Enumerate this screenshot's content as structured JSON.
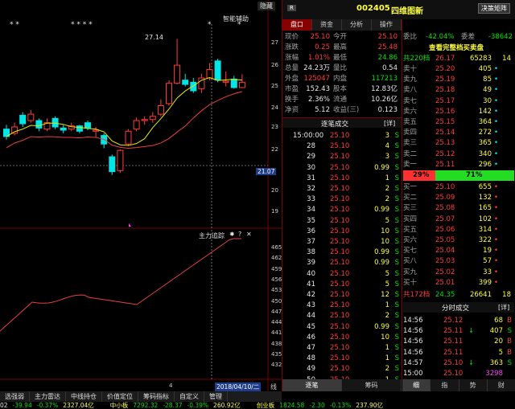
{
  "chart": {
    "top_button": "隐藏",
    "indicator_title": "智能辅助",
    "stars_left": "* *",
    "stars_mid": "* * * *",
    "stars_r1": "*",
    "stars_r2": "*",
    "high_label": "27.14",
    "price_label": "21.07",
    "price_axis": [
      "27",
      "26",
      "25",
      "24",
      "23",
      "22",
      "20",
      "19"
    ],
    "sub_title": "主力追踪",
    "sub_axis": [
      "465",
      "462",
      "459",
      "456",
      "453",
      "450",
      "447",
      "444",
      "441",
      "438",
      "435",
      "432"
    ],
    "date_label": "2018/04/10/二",
    "date_right": "线",
    "page_num": "4",
    "sub_icons": [
      "✸",
      "?",
      "✕"
    ]
  },
  "toolbar": [
    "选强弱",
    "主力雷达",
    "中线持仓",
    "价值定位",
    "筹码指标",
    "自定义",
    "管理"
  ],
  "header": {
    "badge": "R",
    "code": "002405",
    "name": "四维图新",
    "button": "决策矩阵"
  },
  "tabs": [
    "盘口",
    "资金",
    "分析",
    "操作"
  ],
  "quote": [
    {
      "l": "现价",
      "v": "25.10",
      "l2": "今开",
      "v2": "25.10"
    },
    {
      "l": "涨跌",
      "v": "0.25",
      "l2": "最高",
      "v2": "25.48"
    },
    {
      "l": "涨幅",
      "v": "1.01%",
      "l2": "最低",
      "v2": "24.86"
    },
    {
      "l": "总量",
      "v": "24.23万",
      "l2": "量比",
      "v2": "0.54"
    },
    {
      "l": "外盘",
      "v": "125047",
      "l2": "内盘",
      "v2": "117213"
    },
    {
      "l": "市盈",
      "v": "152.43",
      "l2": "股本",
      "v2": "12.83亿"
    },
    {
      "l": "换手",
      "v": "2.36%",
      "l2": "流通",
      "v2": "10.26亿"
    },
    {
      "l": "净资",
      "v": "5.12",
      "l2": "收益(三)",
      "v2": "0.123"
    }
  ],
  "ticks_header": {
    "title": "逐笔成交",
    "detail": "[详]"
  },
  "ticks": [
    {
      "t": "15:00:00",
      "p": "25.10",
      "q": "3",
      "s": "S"
    },
    {
      "t": "28",
      "p": "25.10",
      "q": "4",
      "s": "S"
    },
    {
      "t": "29",
      "p": "25.10",
      "q": "3",
      "s": "S"
    },
    {
      "t": "30",
      "p": "25.10",
      "q": "0.99",
      "s": "S"
    },
    {
      "t": "31",
      "p": "25.10",
      "q": "1",
      "s": "S"
    },
    {
      "t": "32",
      "p": "25.10",
      "q": "2",
      "s": "S"
    },
    {
      "t": "33",
      "p": "25.10",
      "q": "2",
      "s": "S"
    },
    {
      "t": "34",
      "p": "25.10",
      "q": "0.99",
      "s": "S"
    },
    {
      "t": "35",
      "p": "25.10",
      "q": "5",
      "s": "S"
    },
    {
      "t": "36",
      "p": "25.10",
      "q": "10",
      "s": "S"
    },
    {
      "t": "37",
      "p": "25.10",
      "q": "10",
      "s": "S"
    },
    {
      "t": "38",
      "p": "25.10",
      "q": "0.99",
      "s": "S"
    },
    {
      "t": "39",
      "p": "25.10",
      "q": "0.99",
      "s": "S"
    },
    {
      "t": "40",
      "p": "25.10",
      "q": "5",
      "s": "S"
    },
    {
      "t": "41",
      "p": "25.10",
      "q": "5",
      "s": "S"
    },
    {
      "t": "42",
      "p": "25.10",
      "q": "12",
      "s": "S"
    },
    {
      "t": "43",
      "p": "25.10",
      "q": "1",
      "s": "S"
    },
    {
      "t": "44",
      "p": "25.10",
      "q": "2",
      "s": "S"
    },
    {
      "t": "45",
      "p": "25.10",
      "q": "0.99",
      "s": "S"
    },
    {
      "t": "46",
      "p": "25.10",
      "q": "10",
      "s": "S"
    },
    {
      "t": "47",
      "p": "25.10",
      "q": "1",
      "s": "S"
    },
    {
      "t": "48",
      "p": "25.10",
      "q": "1",
      "s": "S"
    },
    {
      "t": "49",
      "p": "25.10",
      "q": "2",
      "s": "S"
    },
    {
      "t": "50",
      "p": "25.10",
      "q": "1",
      "s": "S"
    }
  ],
  "book_top": {
    "wb_label": "委比",
    "wb": "-42.04%",
    "wc_label": "委差",
    "wc": "-38642",
    "link": "查看完整档买卖盘",
    "sum_label": "共220档",
    "sum_price": "26.17",
    "sum_vol": "65283",
    "sum_n": "14"
  },
  "asks": [
    {
      "l": "卖十",
      "p": "25.20",
      "v": "405",
      "m": "•"
    },
    {
      "l": "卖九",
      "p": "25.19",
      "v": "85",
      "m": "•"
    },
    {
      "l": "卖八",
      "p": "25.18",
      "v": "49",
      "m": "•"
    },
    {
      "l": "卖七",
      "p": "25.17",
      "v": "30",
      "m": "•"
    },
    {
      "l": "卖六",
      "p": "25.16",
      "v": "142",
      "m": "•"
    },
    {
      "l": "卖五",
      "p": "25.15",
      "v": "364",
      "m": "•"
    },
    {
      "l": "卖四",
      "p": "25.14",
      "v": "272",
      "m": "•"
    },
    {
      "l": "卖三",
      "p": "25.13",
      "v": "365",
      "m": "•"
    },
    {
      "l": "卖二",
      "p": "25.12",
      "v": "340",
      "m": "•"
    },
    {
      "l": "卖一",
      "p": "25.11",
      "v": "296",
      "m": "•"
    }
  ],
  "ratio": {
    "sell": "29%",
    "buy": "71%",
    "buy_frac": 0.71
  },
  "bids": [
    {
      "l": "买一",
      "p": "25.10",
      "v": "655",
      "m": "•"
    },
    {
      "l": "买二",
      "p": "25.09",
      "v": "132",
      "m": "•"
    },
    {
      "l": "买三",
      "p": "25.08",
      "v": "165",
      "m": "•"
    },
    {
      "l": "买四",
      "p": "25.07",
      "v": "102",
      "m": "•"
    },
    {
      "l": "买五",
      "p": "25.06",
      "v": "314",
      "m": "•"
    },
    {
      "l": "买六",
      "p": "25.05",
      "v": "322",
      "m": "•"
    },
    {
      "l": "买七",
      "p": "25.04",
      "v": "19",
      "m": "•"
    },
    {
      "l": "买八",
      "p": "25.03",
      "v": "57",
      "m": "•"
    },
    {
      "l": "买九",
      "p": "25.02",
      "v": "33",
      "m": "•"
    },
    {
      "l": "买十",
      "p": "25.01",
      "v": "399",
      "m": "•"
    }
  ],
  "book_bottom": {
    "label": "共172档",
    "price": "24.35",
    "vol": "26641",
    "n": "18"
  },
  "minute_header": {
    "title": "分时成交",
    "detail": "[详]"
  },
  "minute": [
    {
      "t": "14:56",
      "p": "25.12",
      "a": "",
      "v": "68",
      "s": "B"
    },
    {
      "t": "14:56",
      "p": "25.11",
      "a": "↓",
      "v": "407",
      "s": "S"
    },
    {
      "t": "14:56",
      "p": "25.11",
      "a": "",
      "v": "20",
      "s": "B"
    },
    {
      "t": "14:56",
      "p": "25.11",
      "a": "",
      "v": "5",
      "s": "B"
    },
    {
      "t": "14:57",
      "p": "25.10",
      "a": "↓",
      "v": "363",
      "s": "S"
    },
    {
      "t": "15:00",
      "p": "25.10",
      "a": "",
      "v": "3298",
      "s": ""
    }
  ],
  "bottom_tabs_left": [
    "逐笔",
    "筹码"
  ],
  "bottom_tabs_right": [
    "细",
    "指",
    "势",
    "财"
  ],
  "ticker": [
    {
      "t": "02",
      "c": "white"
    },
    {
      "t": "-39.94",
      "c": "green"
    },
    {
      "t": "-0.37%",
      "c": "green"
    },
    {
      "t": "2327.04亿",
      "c": "yellow"
    },
    {
      "t": "中小板",
      "c": "yellow"
    },
    {
      "t": "7292.32",
      "c": "green"
    },
    {
      "t": "-28.37",
      "c": "green"
    },
    {
      "t": "-0.39%",
      "c": "green"
    },
    {
      "t": "260.92亿",
      "c": "yellow"
    },
    {
      "t": "创业板",
      "c": "yellow"
    },
    {
      "t": "1824.58",
      "c": "green"
    },
    {
      "t": "-2.30",
      "c": "green"
    },
    {
      "t": "-0.13%",
      "c": "green"
    },
    {
      "t": "237.90亿",
      "c": "yellow"
    }
  ],
  "candles": [
    {
      "o": 22.9,
      "c": 22.55,
      "h": 23.1,
      "l": 22.4
    },
    {
      "o": 22.7,
      "c": 23.0,
      "h": 23.2,
      "l": 22.6
    },
    {
      "o": 23.55,
      "c": 23.15,
      "h": 23.7,
      "l": 23.0
    },
    {
      "o": 23.3,
      "c": 23.6,
      "h": 23.8,
      "l": 23.2
    },
    {
      "o": 23.3,
      "c": 22.95,
      "h": 23.4,
      "l": 22.8
    },
    {
      "o": 22.9,
      "c": 23.2,
      "h": 23.4,
      "l": 22.8
    },
    {
      "o": 23.4,
      "c": 23.0,
      "h": 23.5,
      "l": 22.9
    },
    {
      "o": 22.95,
      "c": 22.85,
      "h": 23.1,
      "l": 22.7
    },
    {
      "o": 22.9,
      "c": 23.05,
      "h": 23.2,
      "l": 22.8
    },
    {
      "o": 23.05,
      "c": 22.8,
      "h": 23.1,
      "l": 22.7
    },
    {
      "o": 23.2,
      "c": 22.95,
      "h": 23.3,
      "l": 22.85
    },
    {
      "o": 22.8,
      "c": 22.85,
      "h": 23.0,
      "l": 22.5
    },
    {
      "o": 22.6,
      "c": 22.2,
      "h": 22.7,
      "l": 22.0
    },
    {
      "o": 21.6,
      "c": 20.9,
      "h": 21.7,
      "l": 20.75
    },
    {
      "o": 20.95,
      "c": 21.9,
      "h": 21.95,
      "l": 20.85
    },
    {
      "o": 22.2,
      "c": 22.8,
      "h": 22.9,
      "l": 22.1
    },
    {
      "o": 22.9,
      "c": 23.3,
      "h": 23.45,
      "l": 22.8
    },
    {
      "o": 23.3,
      "c": 23.35,
      "h": 23.5,
      "l": 23.1
    },
    {
      "o": 23.35,
      "c": 23.5,
      "h": 23.7,
      "l": 23.2
    },
    {
      "o": 23.6,
      "c": 24.0,
      "h": 24.3,
      "l": 23.5
    },
    {
      "o": 24.1,
      "c": 25.05,
      "h": 25.2,
      "l": 24.0
    },
    {
      "o": 25.05,
      "c": 25.9,
      "h": 27.14,
      "l": 25.0
    },
    {
      "o": 25.2,
      "c": 25.0,
      "h": 25.5,
      "l": 24.9
    },
    {
      "o": 25.1,
      "c": 24.7,
      "h": 25.3,
      "l": 24.6
    },
    {
      "o": 24.8,
      "c": 25.3,
      "h": 25.5,
      "l": 24.6
    },
    {
      "o": 25.3,
      "c": 25.7,
      "h": 26.0,
      "l": 25.2
    },
    {
      "o": 26.1,
      "c": 25.2,
      "h": 26.2,
      "l": 25.1
    },
    {
      "o": 25.1,
      "c": 25.15,
      "h": 25.6,
      "l": 24.9
    },
    {
      "o": 25.25,
      "c": 24.85,
      "h": 25.4,
      "l": 24.8
    },
    {
      "o": 24.85,
      "c": 25.1,
      "h": 25.48,
      "l": 24.86
    }
  ]
}
